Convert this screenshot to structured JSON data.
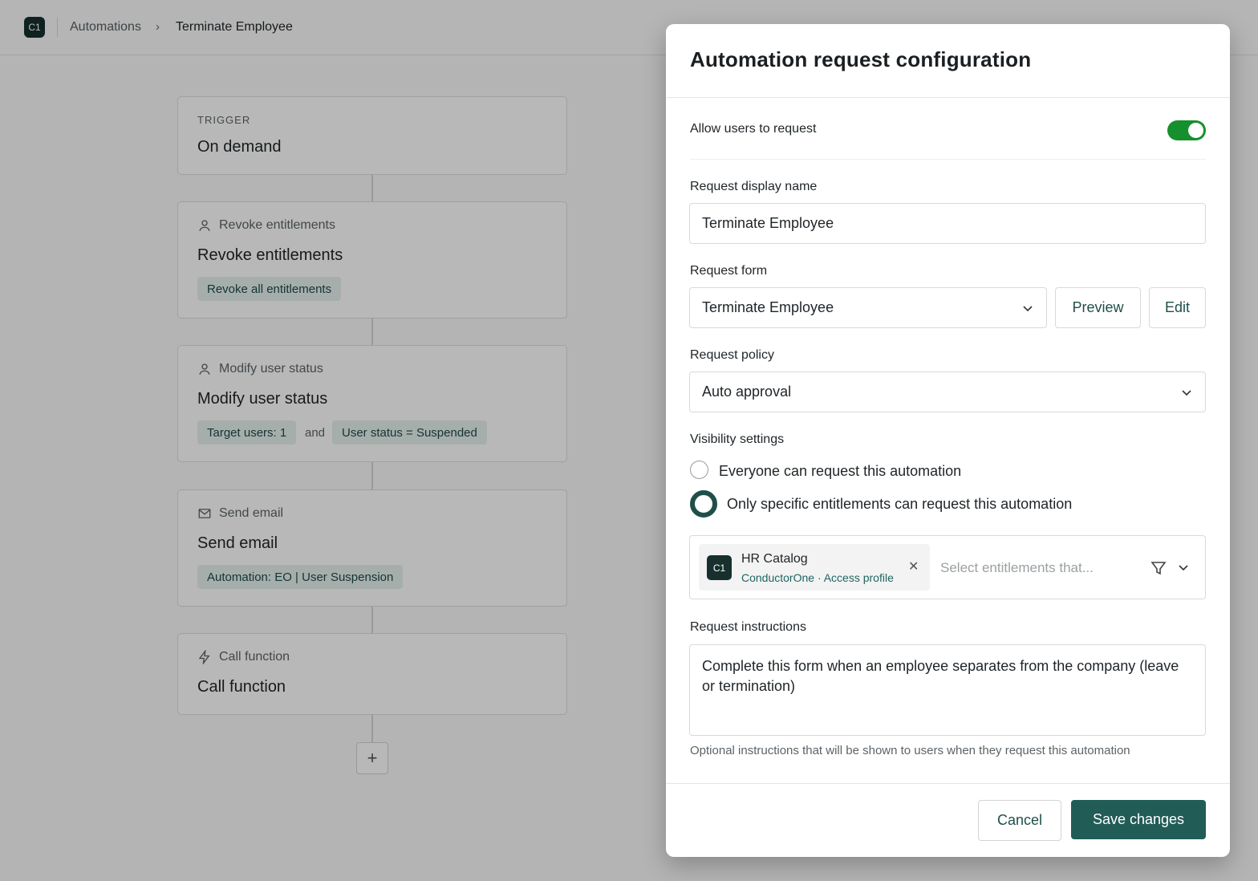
{
  "app": {
    "logo_text": "C1"
  },
  "breadcrumb": {
    "items": [
      "Automations",
      "Terminate Employee"
    ],
    "separator": "›"
  },
  "workflow": {
    "trigger": {
      "kicker": "TRIGGER",
      "title": "On demand"
    },
    "steps": [
      {
        "icon": "user-icon",
        "subtitle": "Revoke entitlements",
        "title": "Revoke entitlements",
        "chips": [
          "Revoke all entitlements"
        ]
      },
      {
        "icon": "user-icon",
        "subtitle": "Modify user status",
        "title": "Modify user status",
        "chips": [
          "Target users: 1",
          "User status = Suspended"
        ],
        "joiner": "and"
      },
      {
        "icon": "mail-icon",
        "subtitle": "Send email",
        "title": "Send email",
        "chips": [
          "Automation: EO | User Suspension"
        ]
      },
      {
        "icon": "lightning-icon",
        "subtitle": "Call function",
        "title": "Call function",
        "chips": []
      }
    ],
    "add_step_label": "+"
  },
  "modal": {
    "title": "Automation request configuration",
    "allow_requests": {
      "label": "Allow users to request",
      "enabled": true
    },
    "display_name": {
      "label": "Request display name",
      "value": "Terminate Employee"
    },
    "request_form": {
      "label": "Request form",
      "value": "Terminate Employee",
      "preview_label": "Preview",
      "edit_label": "Edit"
    },
    "request_policy": {
      "label": "Request policy",
      "value": "Auto approval"
    },
    "visibility": {
      "label": "Visibility settings",
      "options": [
        {
          "label": "Everyone can request this automation",
          "selected": false
        },
        {
          "label": "Only specific entitlements can request this automation",
          "selected": true
        }
      ]
    },
    "entitlements": {
      "selected": [
        {
          "logo_text": "C1",
          "name": "HR Catalog",
          "meta": "ConductorOne · Access profile"
        }
      ],
      "placeholder": "Select entitlements that..."
    },
    "instructions": {
      "label": "Request instructions",
      "value": "Complete this form when an employee separates from the company (leave or termination)",
      "help": "Optional instructions that will be shown to users when they request this automation"
    },
    "footer": {
      "cancel_label": "Cancel",
      "save_label": "Save changes"
    }
  },
  "colors": {
    "accent": "#225c57",
    "toggle_on": "#15902c",
    "chip_bg": "#e7f1ef",
    "logo_bg": "#17302d"
  }
}
